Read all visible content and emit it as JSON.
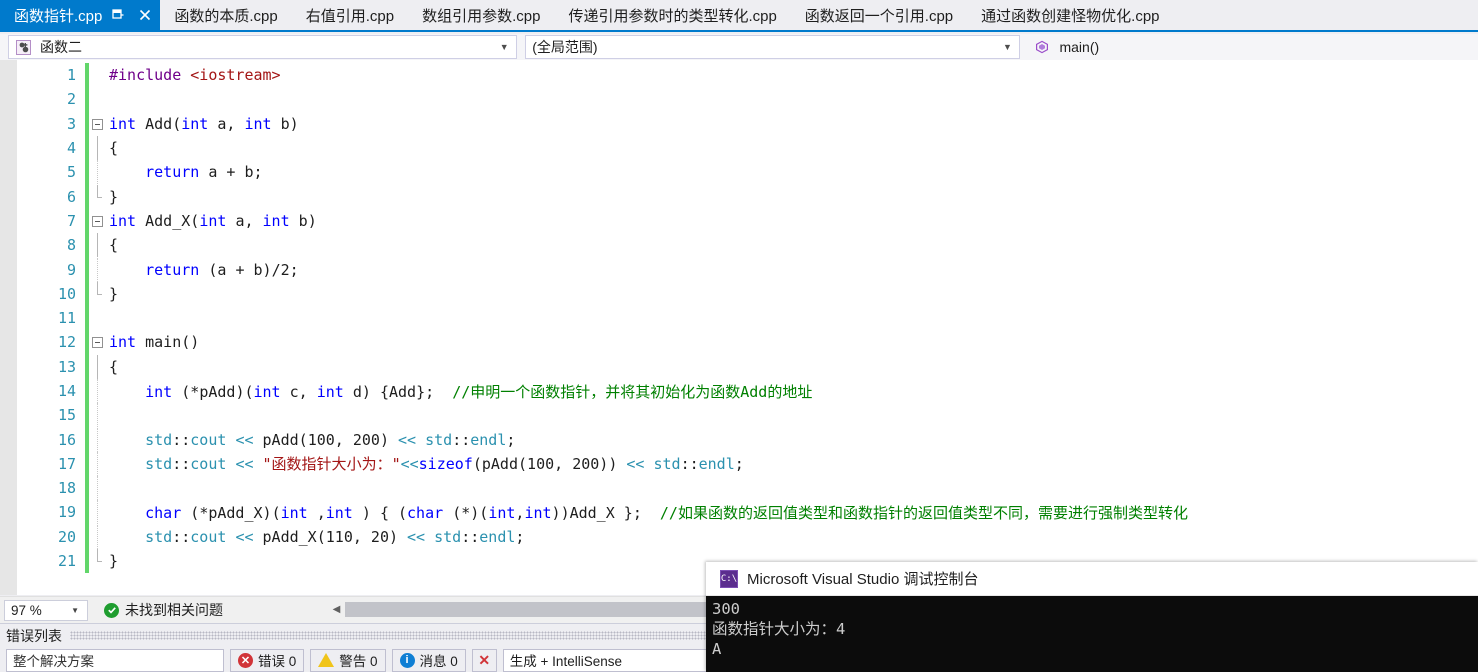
{
  "tabs": [
    {
      "label": "函数指针.cpp",
      "active": true
    },
    {
      "label": "函数的本质.cpp",
      "active": false
    },
    {
      "label": "右值引用.cpp",
      "active": false
    },
    {
      "label": "数组引用参数.cpp",
      "active": false
    },
    {
      "label": "传递引用参数时的类型转化.cpp",
      "active": false
    },
    {
      "label": "函数返回一个引用.cpp",
      "active": false
    },
    {
      "label": "通过函数创建怪物优化.cpp",
      "active": false
    }
  ],
  "navbar": {
    "project": "函数二",
    "scope": "(全局范围)",
    "member": "main()"
  },
  "editor": {
    "lines": [
      {
        "num": "1",
        "glyph": "",
        "code": "#include <iostream>"
      },
      {
        "num": "2",
        "glyph": "",
        "code": ""
      },
      {
        "num": "3",
        "glyph": "fold",
        "code": "int Add(int a, int b)"
      },
      {
        "num": "4",
        "glyph": "line",
        "code": "{"
      },
      {
        "num": "5",
        "glyph": "dash",
        "code": "    return a + b;"
      },
      {
        "num": "6",
        "glyph": "corner",
        "code": "}"
      },
      {
        "num": "7",
        "glyph": "fold",
        "code": "int Add_X(int a, int b)"
      },
      {
        "num": "8",
        "glyph": "line",
        "code": "{"
      },
      {
        "num": "9",
        "glyph": "dash",
        "code": "    return (a + b)/2;"
      },
      {
        "num": "10",
        "glyph": "corner",
        "code": "}"
      },
      {
        "num": "11",
        "glyph": "",
        "code": ""
      },
      {
        "num": "12",
        "glyph": "fold",
        "code": "int main()"
      },
      {
        "num": "13",
        "glyph": "line",
        "code": "{"
      },
      {
        "num": "14",
        "glyph": "dash",
        "code": "    int (*pAdd)(int c, int d) {Add};  //申明一个函数指针，并将其初始化为函数Add的地址"
      },
      {
        "num": "15",
        "glyph": "dash",
        "code": ""
      },
      {
        "num": "16",
        "glyph": "dash",
        "code": "    std::cout << pAdd(100, 200) << std::endl;"
      },
      {
        "num": "17",
        "glyph": "dash",
        "code": "    std::cout << \"函数指针大小为：\"<<sizeof(pAdd(100, 200)) << std::endl;"
      },
      {
        "num": "18",
        "glyph": "dash",
        "code": ""
      },
      {
        "num": "19",
        "glyph": "dash",
        "code": "    char (*pAdd_X)(int ,int ) { (char (*)(int,int))Add_X };  //如果函数的返回值类型和函数指针的返回值类型不同，需要进行强制类型转化"
      },
      {
        "num": "20",
        "glyph": "dash",
        "code": "    std::cout << pAdd_X(110, 20) << std::endl;"
      },
      {
        "num": "21",
        "glyph": "corner",
        "code": "}"
      }
    ]
  },
  "status": {
    "zoom": "97 %",
    "issues": "未找到相关问题"
  },
  "errorlist": {
    "title": "错误列表",
    "search_placeholder": "整个解决方案",
    "errors_label": "错误 0",
    "warnings_label": "警告 0",
    "messages_label": "消息 0",
    "clear_label": "✕",
    "filter_label": "生成 + IntelliSense"
  },
  "console": {
    "title": "Microsoft Visual Studio 调试控制台",
    "icon_text": "C:\\",
    "output": [
      "300",
      "函数指针大小为：4",
      "A"
    ]
  },
  "colors": {
    "accent": "#007acc",
    "keyword": "#0000ff",
    "type": "#2b91af",
    "comment": "#008000",
    "string": "#a31515",
    "changebar": "#62d66a"
  }
}
